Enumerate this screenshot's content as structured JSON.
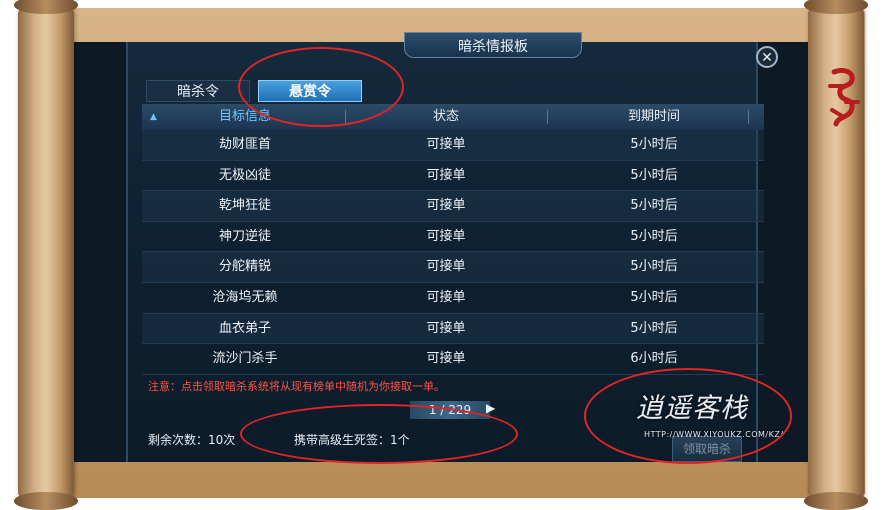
{
  "window": {
    "title": "暗杀情报板",
    "close_label": "✕"
  },
  "tabs": [
    {
      "label": "暗杀令",
      "active": false
    },
    {
      "label": "悬赏令",
      "active": true
    }
  ],
  "table": {
    "headers": {
      "target": "目标信息",
      "status": "状态",
      "expiry": "到期时间"
    },
    "rows": [
      {
        "target": "劫财匪首",
        "status": "可接单",
        "expiry": "5小时后"
      },
      {
        "target": "无极凶徒",
        "status": "可接单",
        "expiry": "5小时后"
      },
      {
        "target": "乾坤狂徒",
        "status": "可接单",
        "expiry": "5小时后"
      },
      {
        "target": "神刀逆徒",
        "status": "可接单",
        "expiry": "5小时后"
      },
      {
        "target": "分舵精锐",
        "status": "可接单",
        "expiry": "5小时后"
      },
      {
        "target": "沧海坞无赖",
        "status": "可接单",
        "expiry": "5小时后"
      },
      {
        "target": "血衣弟子",
        "status": "可接单",
        "expiry": "5小时后"
      },
      {
        "target": "流沙门杀手",
        "status": "可接单",
        "expiry": "6小时后"
      }
    ]
  },
  "notice": "注意：点击领取暗杀系统将从现有榜单中随机为你接取一单。",
  "pager": {
    "text": "1 / 229"
  },
  "footer": {
    "remaining": "剩余次数：10次",
    "carry": "携带高级生死签：1个",
    "accept_button": "领取暗杀"
  },
  "watermark": {
    "title": "逍遥客栈",
    "url": "HTTP://WWW.XIYOUKZ.COM/KZ/"
  },
  "colors": {
    "accent": "#3d8fd6",
    "notice": "#ff5145",
    "annotation": "#e12424"
  }
}
